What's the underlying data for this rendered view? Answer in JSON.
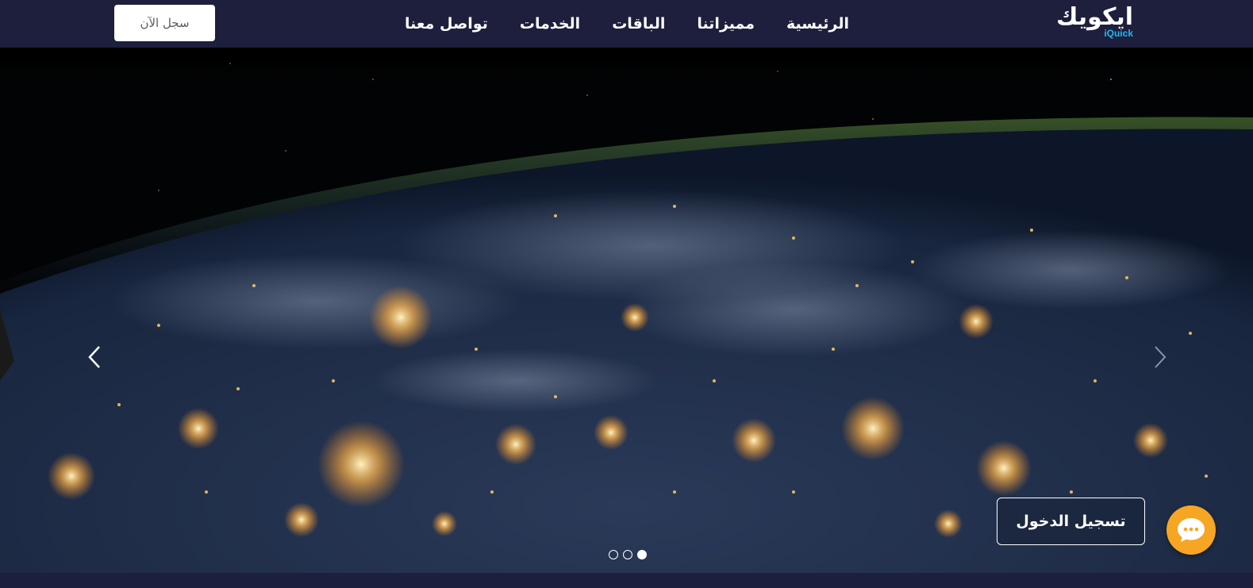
{
  "header": {
    "register_label": "سجل الآن",
    "nav": [
      "الرئيسية",
      "مميزاتنا",
      "الباقات",
      "الخدمات",
      "تواصل معنا"
    ],
    "logo_ar": "ايكويك",
    "logo_en": "iQuick",
    "background": "#1d1f3d"
  },
  "hero": {
    "login_label": "تسجيل الدخول",
    "slides_count": 3,
    "active_slide": 3
  },
  "colors": {
    "accent_orange": "#f6a623",
    "logo_blue": "#22b8f0"
  },
  "icons": [
    "arrow-left-icon",
    "arrow-right-icon",
    "chat-icon",
    "map-pin-icon"
  ]
}
